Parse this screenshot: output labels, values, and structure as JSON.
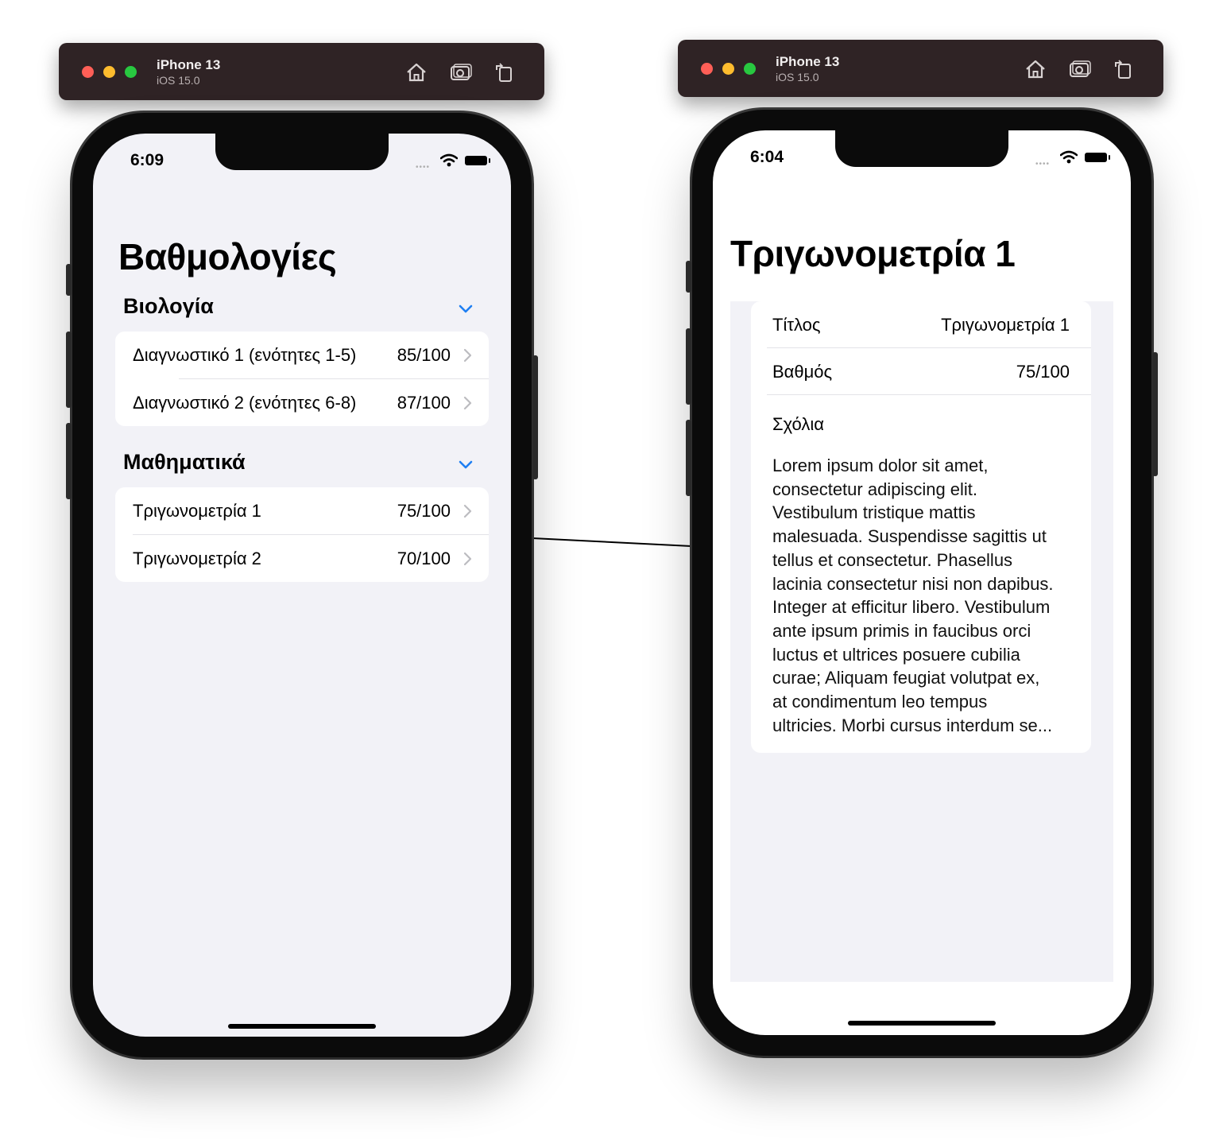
{
  "left": {
    "toolbar": {
      "device": "iPhone 13",
      "os": "iOS 15.0"
    },
    "status": {
      "time": "6:09"
    },
    "title": "Βαθμολογίες",
    "sections": [
      {
        "title": "Βιολογία",
        "rows": [
          {
            "label": "Διαγνωστικό 1 (ενότητες 1-5)",
            "value": "85/100"
          },
          {
            "label": "Διαγνωστικό 2 (ενότητες 6-8)",
            "value": "87/100"
          }
        ]
      },
      {
        "title": "Μαθηματικά",
        "rows": [
          {
            "label": "Τριγωνομετρία 1",
            "value": "75/100"
          },
          {
            "label": "Τριγωνομετρία 2",
            "value": "70/100"
          }
        ]
      }
    ]
  },
  "right": {
    "toolbar": {
      "device": "iPhone 13",
      "os": "iOS 15.0"
    },
    "status": {
      "time": "6:04"
    },
    "title": "Τριγωνομετρία 1",
    "fields": [
      {
        "label": "Τίτλος",
        "value": "Τριγωνομετρία 1"
      },
      {
        "label": "Βαθμός",
        "value": "75/100"
      }
    ],
    "comments_label": "Σχόλια",
    "comments_lines": [
      "Lorem ipsum dolor sit amet,",
      "consectetur adipiscing elit.",
      "Vestibulum tristique mattis",
      "malesuada. Suspendisse sagittis ut",
      "tellus et consectetur. Phasellus",
      "lacinia consectetur nisi non dapibus.",
      "Integer at efficitur libero. Vestibulum",
      "ante ipsum primis in faucibus orci",
      "luctus et ultrices posuere cubilia",
      "curae; Aliquam feugiat volutpat ex,",
      "at condimentum leo tempus",
      "ultricies. Morbi cursus interdum se..."
    ]
  },
  "colors": {
    "accent": "#1f7ff2",
    "grouped_background": "#f2f2f7",
    "toolbar": "#2f2325"
  },
  "icons": [
    "home-icon",
    "screenshot-icon",
    "rotate-icon",
    "chevron-down-icon",
    "chevron-right-icon",
    "wifi-icon",
    "battery-icon",
    "cellular-signal-icon"
  ]
}
